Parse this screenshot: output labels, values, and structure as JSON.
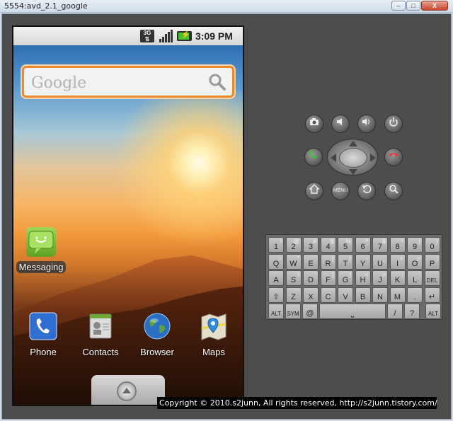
{
  "window": {
    "title": "5554:avd_2.1_google",
    "btn_min": "–",
    "btn_max": "□",
    "btn_close": "X"
  },
  "statusbar": {
    "network": "3G",
    "time": "3:09 PM"
  },
  "search": {
    "placeholder": "Google"
  },
  "apps": {
    "messaging": "Messaging",
    "phone": "Phone",
    "contacts": "Contacts",
    "browser": "Browser",
    "maps": "Maps"
  },
  "controls": {
    "menu": "MENU"
  },
  "keyboard": {
    "row1": [
      [
        "1",
        "!"
      ],
      [
        "2",
        "@"
      ],
      [
        "3",
        "#"
      ],
      [
        "4",
        "$"
      ],
      [
        "5",
        "%"
      ],
      [
        "6",
        "^"
      ],
      [
        "7",
        "&"
      ],
      [
        "8",
        "*"
      ],
      [
        "9",
        "("
      ],
      [
        "0",
        ")"
      ]
    ],
    "row2": [
      [
        "Q",
        "~"
      ],
      [
        "W",
        "\""
      ],
      [
        "E",
        "`"
      ],
      [
        "R",
        "{"
      ],
      [
        "T",
        "}"
      ],
      [
        "Y",
        "-"
      ],
      [
        "U",
        "_"
      ],
      [
        "I",
        "+"
      ],
      [
        "O",
        "="
      ],
      [
        "P",
        "¦"
      ]
    ],
    "row3": [
      [
        "A",
        ""
      ],
      [
        "S",
        "\\"
      ],
      [
        "D",
        "'"
      ],
      [
        "F",
        "["
      ],
      [
        "G",
        "]"
      ],
      [
        "H",
        "<"
      ],
      [
        "J",
        ">"
      ],
      [
        "K",
        ";"
      ],
      [
        "L",
        ":"
      ],
      [
        "DEL",
        ""
      ]
    ],
    "row4": [
      [
        "⇧",
        ""
      ],
      [
        "Z",
        ""
      ],
      [
        "X",
        ""
      ],
      [
        "C",
        ""
      ],
      [
        "V",
        ""
      ],
      [
        "B",
        ""
      ],
      [
        "N",
        ""
      ],
      [
        "M",
        ""
      ],
      [
        ".",
        ""
      ],
      [
        "↵",
        ""
      ]
    ],
    "row5": {
      "alt_left": "ALT",
      "sym": "SYM",
      "at": "@",
      "space": "⎵",
      "slash": "/",
      "question": "?",
      "comma": ",",
      "alt_right": "ALT"
    }
  },
  "footer": {
    "copyright": "Copyright © 2010.s2junn, All rights reserved, http://s2junn.tistory.com/"
  }
}
